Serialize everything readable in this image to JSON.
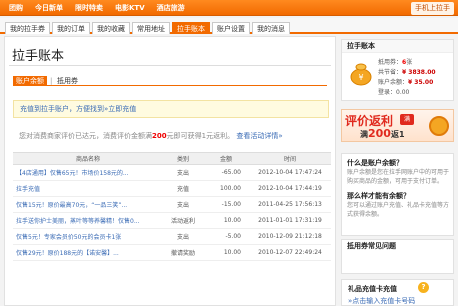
{
  "topnav": {
    "items": [
      "团购",
      "今日新单",
      "限时特卖",
      "电影KTV",
      "酒店旅游"
    ],
    "mobile": "手机上拉手"
  },
  "subnav": {
    "tabs": [
      "我的拉手券",
      "我的订单",
      "我的收藏",
      "常用地址",
      "拉手账本",
      "账户设置",
      "我的消息"
    ],
    "active_index": 4
  },
  "main": {
    "title": "拉手账本",
    "tab_balance": "账户余额",
    "tab_sep": "|",
    "tab_coupon": "抵用券",
    "notice_pre": "充值到拉手账户，方便找到",
    "notice_link": "»立即充值",
    "rebate_pre": "您对消费商家评价已达元，消费评价金额满",
    "rebate_amount": "200",
    "rebate_mid": "元即可获得1元返利。",
    "rebate_link": "查看活动详情»",
    "table": {
      "headers": [
        "商品名称",
        "类别",
        "金额",
        "时间"
      ],
      "rows": [
        {
          "desc": "【4店通用】仅售65元！市场价158元的...",
          "type": "支出",
          "amount": "-65.00",
          "time": "2012-10-04 17:47:24"
        },
        {
          "desc": "拉手充值",
          "type": "充值",
          "amount": "100.00",
          "time": "2012-10-04 17:44:19"
        },
        {
          "desc": "仅售15元！原价最高70元，“一品三笑”...",
          "type": "支出",
          "amount": "-15.00",
          "time": "2011-04-25 17:56:13"
        },
        {
          "desc": "拉手送你护士美丽，蒸叶等等养馨精！仅售0...",
          "type": "活动返利",
          "amount": "10.00",
          "time": "2011-01-01 17:31:19"
        },
        {
          "desc": "仅售5元！专家会员价50元的会员卡1张",
          "type": "支出",
          "amount": "-5.00",
          "time": "2010-12-09 21:12:18"
        },
        {
          "desc": "仅售29元！原价188元的【诺安馨】...",
          "type": "撤请奖励",
          "amount": "10.00",
          "time": "2010-12-07 22:49:24"
        }
      ]
    }
  },
  "sidebar": {
    "account": {
      "title": "拉手账本",
      "coupon_label": "抵用券：",
      "coupon_value": "6",
      "coupon_unit": "张",
      "saved_label": "共节省：",
      "saved_value": "¥ 3838.00",
      "balance_label": "账户余额：",
      "balance_value": "¥ 35.00",
      "login_label": "登录：",
      "login_value": "0.00"
    },
    "promo": {
      "line1": "评价返利",
      "tag": "满",
      "line2_pre": "满",
      "line2_amount": "200",
      "line2_post": "返1"
    },
    "faq1": {
      "q1": "什么是账户余额？",
      "a1": "账户余额是您在拉手网账户中的可用于购买商品的金额，可用于支付订单。",
      "q2": "那么样才能有余额？",
      "a2": "您可以通过账户充值、礼品卡充值等方式获得余额。"
    },
    "faq2": {
      "title": "抵用券常见问题"
    },
    "gift_card": {
      "title": "礼品充值卡充值",
      "q": "?",
      "link": "»点击输入充值卡号码"
    }
  }
}
